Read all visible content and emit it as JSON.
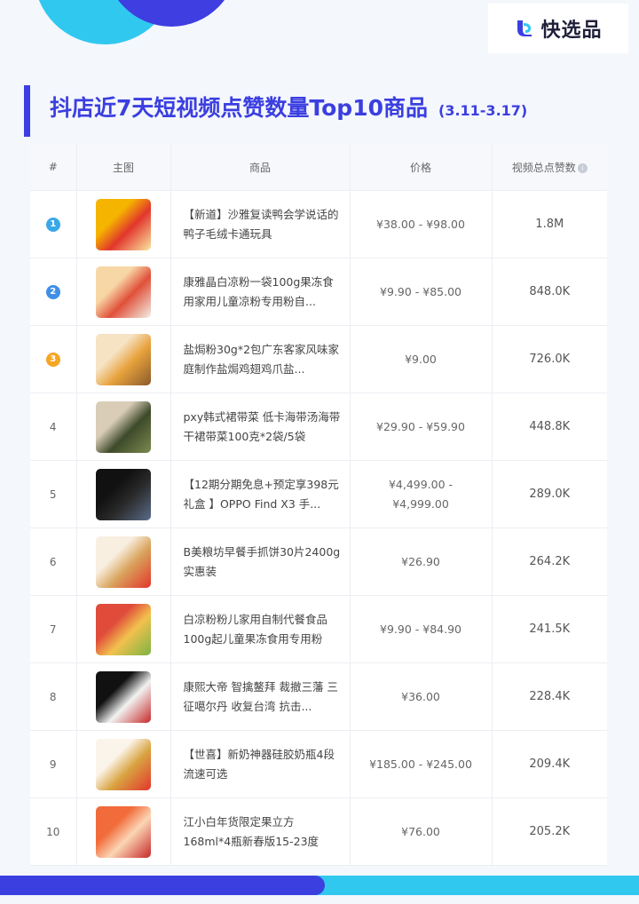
{
  "brand": {
    "name": "快选品"
  },
  "header": {
    "title": "抖店近7天短视频点赞数量Top10商品",
    "date_range": "(3.11-3.17)"
  },
  "table": {
    "columns": [
      "#",
      "主图",
      "商品",
      "价格",
      "视频总点赞数"
    ],
    "rows": [
      {
        "rank": "1",
        "name": "【新道】沙雅复读鸭会学说话的鸭子毛绒卡通玩具",
        "price": "¥38.00 - ¥98.00",
        "likes": "1.8M",
        "badge_color": "#3aa7e8",
        "thumb": [
          "#f5b400",
          "#e2362c",
          "#fbe7a1"
        ]
      },
      {
        "rank": "2",
        "name": "康雅晶白凉粉一袋100g果冻食用家用儿童凉粉专用粉自...",
        "price": "¥9.90 - ¥85.00",
        "likes": "848.0K",
        "badge_color": "#3f8fe6",
        "thumb": [
          "#f8d7a6",
          "#e0503a",
          "#f3f0e6"
        ]
      },
      {
        "rank": "3",
        "name": "盐焗粉30g*2包广东客家风味家庭制作盐焗鸡翅鸡爪盐...",
        "price": "¥9.00",
        "likes": "726.0K",
        "badge_color": "#f5a623",
        "thumb": [
          "#f6e3c4",
          "#e8a23d",
          "#8a5a2b"
        ]
      },
      {
        "rank": "4",
        "name": "pxy韩式裙带菜 低卡海带汤海带干裙带菜100克*2袋/5袋",
        "price": "¥29.90 - ¥59.90",
        "likes": "448.8K",
        "badge_color": "",
        "thumb": [
          "#d9cdb8",
          "#3d4a2a",
          "#7c8a4f"
        ]
      },
      {
        "rank": "5",
        "name": "【12期分期免息+预定享398元礼盒 】OPPO Find X3 手...",
        "price": "¥4,499.00 - ¥4,999.00",
        "likes": "289.0K",
        "badge_color": "",
        "thumb": [
          "#111111",
          "#2a2a2a",
          "#5a6c8a"
        ]
      },
      {
        "rank": "6",
        "name": "B美粮坊早餐手抓饼30片2400g实惠装",
        "price": "¥26.90",
        "likes": "264.2K",
        "badge_color": "",
        "thumb": [
          "#f8efe0",
          "#d9a35c",
          "#e2362c"
        ]
      },
      {
        "rank": "7",
        "name": "白凉粉粉儿家用自制代餐食品100g起儿童果冻食用专用粉",
        "price": "¥9.90 - ¥84.90",
        "likes": "241.5K",
        "badge_color": "",
        "thumb": [
          "#e04b3a",
          "#f2c14e",
          "#7cb342"
        ]
      },
      {
        "rank": "8",
        "name": "康熙大帝 智擒鳌拜 裁撤三藩 三征噶尔丹 收复台湾 抗击...",
        "price": "¥36.00",
        "likes": "228.4K",
        "badge_color": "",
        "thumb": [
          "#111111",
          "#f2f2f2",
          "#c62828"
        ]
      },
      {
        "rank": "9",
        "name": "【世喜】新奶神器硅胶奶瓶4段流速可选",
        "price": "¥185.00 - ¥245.00",
        "likes": "209.4K",
        "badge_color": "",
        "thumb": [
          "#fbf4ea",
          "#d9a441",
          "#e2362c"
        ]
      },
      {
        "rank": "10",
        "name": "江小白年货限定果立方168ml*4瓶新春版15-23度",
        "price": "¥76.00",
        "likes": "205.2K",
        "badge_color": "",
        "thumb": [
          "#f26b3a",
          "#fbd5b5",
          "#c62828"
        ]
      }
    ]
  },
  "colors": {
    "accent": "#3b3fe0",
    "cyan": "#31c8ef",
    "background": "#f4f7fc"
  },
  "icons": {
    "info": "info-circle-icon",
    "logo": "kuaixuanpin-logo-icon"
  }
}
